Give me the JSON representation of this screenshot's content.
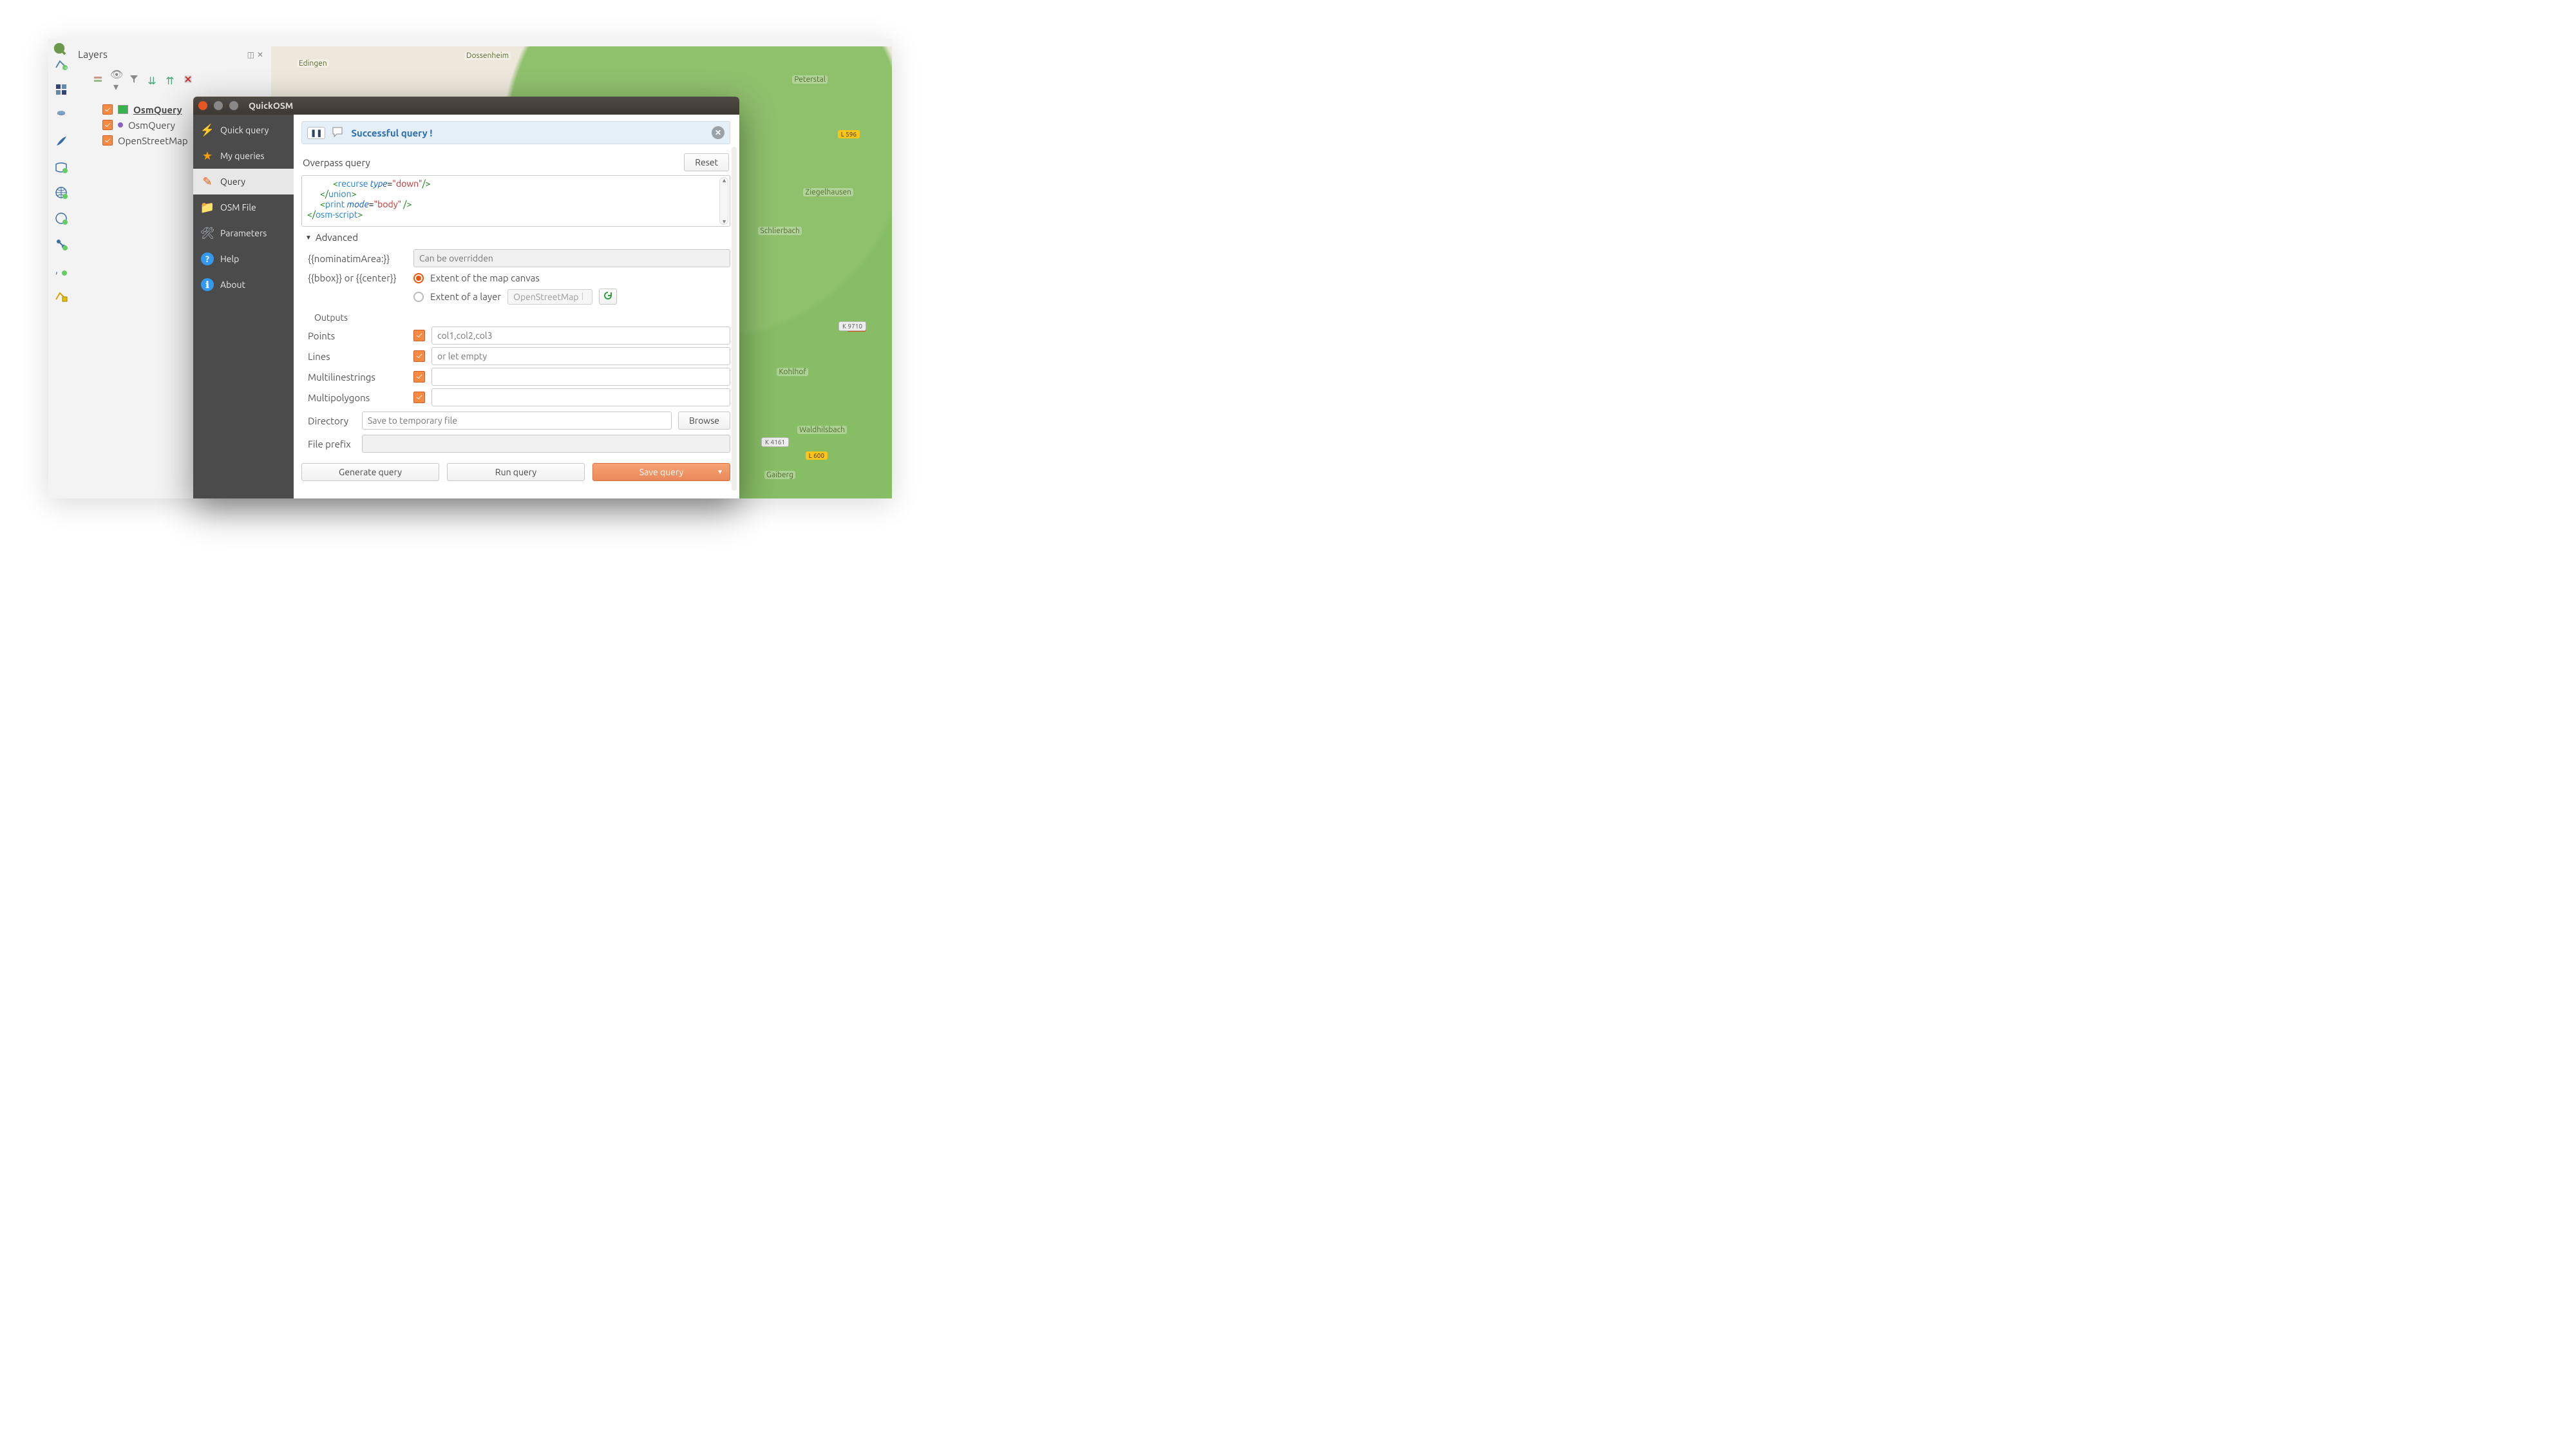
{
  "app": {
    "logo_alt": "QGIS"
  },
  "layers_panel": {
    "title": "Layers",
    "items": [
      {
        "label": "OsmQuery",
        "bold": true,
        "swatch": "green"
      },
      {
        "label": "OsmQuery",
        "bold": false,
        "swatch": "purple"
      },
      {
        "label": "OpenStreetMap",
        "bold": false,
        "swatch": "none"
      }
    ]
  },
  "map_labels": [
    "Dossenheim",
    "Peterstal",
    "Ziegelhausen",
    "Schlierbach",
    "Waldhilsbach",
    "Gaiberg",
    "Kohlhof",
    "Edingen"
  ],
  "dialog": {
    "title": "QuickOSM",
    "nav": [
      {
        "label": "Quick query",
        "icon": "bolt"
      },
      {
        "label": "My queries",
        "icon": "star"
      },
      {
        "label": "Query",
        "icon": "pencil",
        "active": true
      },
      {
        "label": "OSM File",
        "icon": "folder"
      },
      {
        "label": "Parameters",
        "icon": "tools"
      },
      {
        "label": "Help",
        "icon": "help"
      },
      {
        "label": "About",
        "icon": "info"
      }
    ],
    "banner": "Successful query !",
    "overpass": {
      "heading": "Overpass query",
      "reset": "Reset",
      "code_lines": [
        {
          "indent": 4,
          "parts": [
            [
              "tag",
              "<"
            ],
            [
              "name",
              "recurse"
            ],
            [
              "text",
              " "
            ],
            [
              "attr",
              "type"
            ],
            [
              "text",
              "="
            ],
            [
              "str",
              "\"down\""
            ],
            [
              "tag",
              "/>"
            ]
          ]
        },
        {
          "indent": 2,
          "parts": [
            [
              "tag",
              "</"
            ],
            [
              "name",
              "union"
            ],
            [
              "tag",
              ">"
            ]
          ]
        },
        {
          "indent": 2,
          "parts": [
            [
              "tag",
              "<"
            ],
            [
              "name",
              "print"
            ],
            [
              "text",
              " "
            ],
            [
              "attr",
              "mode"
            ],
            [
              "text",
              "="
            ],
            [
              "str",
              "\"body\""
            ],
            [
              "text",
              " "
            ],
            [
              "tag",
              "/>"
            ]
          ]
        },
        {
          "indent": 0,
          "parts": [
            [
              "tag",
              "</"
            ],
            [
              "name",
              "osm-script"
            ],
            [
              "tag",
              ">"
            ]
          ]
        }
      ]
    },
    "advanced": {
      "heading": "Advanced",
      "nominatim_label": "{{nominatimArea:}}",
      "nominatim_placeholder": "Can be overridden",
      "bbox_label": "{{bbox}} or {{center}}",
      "extent_canvas": "Extent of the map canvas",
      "extent_layer": "Extent of a layer",
      "layer_select": "OpenStreetMap",
      "outputs_heading": "Outputs",
      "outputs": [
        {
          "label": "Points",
          "checked": true,
          "placeholder": "col1,col2,col3"
        },
        {
          "label": "Lines",
          "checked": true,
          "placeholder": "or let empty"
        },
        {
          "label": "Multilinestrings",
          "checked": true,
          "placeholder": ""
        },
        {
          "label": "Multipolygons",
          "checked": true,
          "placeholder": ""
        }
      ],
      "directory_label": "Directory",
      "directory_placeholder": "Save to temporary file",
      "browse": "Browse",
      "fileprefix_label": "File prefix"
    },
    "footer": {
      "generate": "Generate query",
      "run": "Run query",
      "save": "Save query"
    }
  }
}
